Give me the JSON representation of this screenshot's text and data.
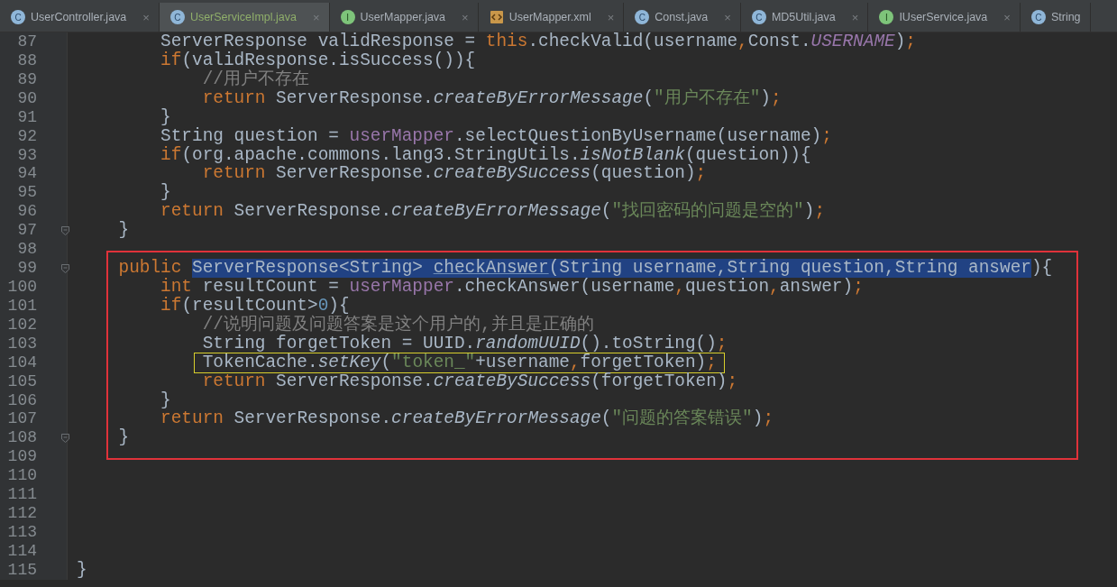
{
  "tabs": [
    {
      "label": "UserController.java",
      "kind": "class",
      "icon_letter": "C",
      "selected": false,
      "close": "×"
    },
    {
      "label": "UserServiceImpl.java",
      "kind": "class",
      "icon_letter": "C",
      "selected": true,
      "close": "×"
    },
    {
      "label": "UserMapper.java",
      "kind": "interface",
      "icon_letter": "I",
      "selected": false,
      "close": "×"
    },
    {
      "label": "UserMapper.xml",
      "kind": "xml",
      "selected": false,
      "close": "×"
    },
    {
      "label": "Const.java",
      "kind": "class",
      "icon_letter": "C",
      "selected": false,
      "close": "×"
    },
    {
      "label": "MD5Util.java",
      "kind": "class",
      "icon_letter": "C",
      "selected": false,
      "close": "×"
    },
    {
      "label": "IUserService.java",
      "kind": "interface",
      "icon_letter": "I",
      "selected": false,
      "close": "×"
    },
    {
      "label": "String",
      "kind": "class",
      "icon_letter": "C",
      "selected": false
    }
  ],
  "editor": {
    "sections": [
      {
        "boxed": false,
        "lines": [
          {
            "number": "87",
            "fold": false,
            "boxed": false,
            "tokens": [
              {
                "text": "        ServerResponse validResponse = ",
                "kind": "plain"
              },
              {
                "text": "this",
                "kind": "keyword"
              },
              {
                "text": ".checkValid(username",
                "kind": "plain"
              },
              {
                "text": ",",
                "kind": "keyword"
              },
              {
                "text": "Const.",
                "kind": "plain"
              },
              {
                "text": "USERNAME",
                "kind": "static-field"
              },
              {
                "text": ")",
                "kind": "plain"
              },
              {
                "text": ";",
                "kind": "keyword"
              }
            ]
          },
          {
            "number": "88",
            "fold": false,
            "boxed": false,
            "tokens": [
              {
                "text": "        if",
                "kind": "keyword"
              },
              {
                "text": "(validResponse.isSuccess()){",
                "kind": "plain"
              }
            ]
          },
          {
            "number": "89",
            "fold": false,
            "boxed": false,
            "tokens": [
              {
                "text": "            //用户不存在",
                "kind": "comment"
              }
            ]
          },
          {
            "number": "90",
            "fold": false,
            "boxed": false,
            "tokens": [
              {
                "text": "            return",
                "kind": "keyword"
              },
              {
                "text": " ServerResponse.",
                "kind": "plain"
              },
              {
                "text": "createByErrorMessage",
                "kind": "static"
              },
              {
                "text": "(",
                "kind": "plain"
              },
              {
                "text": "\"用户不存在\"",
                "kind": "string"
              },
              {
                "text": ")",
                "kind": "plain"
              },
              {
                "text": ";",
                "kind": "keyword"
              }
            ]
          },
          {
            "number": "91",
            "fold": false,
            "boxed": false,
            "tokens": [
              {
                "text": "        }",
                "kind": "plain"
              }
            ]
          },
          {
            "number": "92",
            "fold": false,
            "boxed": false,
            "tokens": [
              {
                "text": "        String question = ",
                "kind": "plain"
              },
              {
                "text": "userMapper",
                "kind": "field"
              },
              {
                "text": ".selectQuestionByUsername(username)",
                "kind": "plain"
              },
              {
                "text": ";",
                "kind": "keyword"
              }
            ]
          },
          {
            "number": "93",
            "fold": false,
            "boxed": false,
            "tokens": [
              {
                "text": "        if",
                "kind": "keyword"
              },
              {
                "text": "(org.apache.commons.lang3.StringUtils.",
                "kind": "plain"
              },
              {
                "text": "isNotBlank",
                "kind": "static"
              },
              {
                "text": "(question)){",
                "kind": "plain"
              }
            ]
          },
          {
            "number": "94",
            "fold": false,
            "boxed": false,
            "tokens": [
              {
                "text": "            return",
                "kind": "keyword"
              },
              {
                "text": " ServerResponse.",
                "kind": "plain"
              },
              {
                "text": "createBySuccess",
                "kind": "static"
              },
              {
                "text": "(question)",
                "kind": "plain"
              },
              {
                "text": ";",
                "kind": "keyword"
              }
            ]
          },
          {
            "number": "95",
            "fold": false,
            "boxed": false,
            "tokens": [
              {
                "text": "        }",
                "kind": "plain"
              }
            ]
          },
          {
            "number": "96",
            "fold": false,
            "boxed": false,
            "tokens": [
              {
                "text": "        return",
                "kind": "keyword"
              },
              {
                "text": " ServerResponse.",
                "kind": "plain"
              },
              {
                "text": "createByErrorMessage",
                "kind": "static"
              },
              {
                "text": "(",
                "kind": "plain"
              },
              {
                "text": "\"找回密码的问题是空的\"",
                "kind": "string"
              },
              {
                "text": ")",
                "kind": "plain"
              },
              {
                "text": ";",
                "kind": "keyword"
              }
            ]
          },
          {
            "number": "97",
            "fold": true,
            "boxed": false,
            "tokens": [
              {
                "text": "    }",
                "kind": "plain"
              }
            ]
          },
          {
            "number": "98",
            "fold": false
          }
        ]
      },
      {
        "boxed": true,
        "lines": [
          {
            "number": "99",
            "fold": true,
            "boxed": false,
            "tokens": [
              {
                "text": "    public ",
                "kind": "keyword",
                "selected": false
              },
              {
                "text": "ServerResponse<String> ",
                "kind": "plain",
                "selected": true
              },
              {
                "text": "checkAnswer",
                "kind": "declaration",
                "selected": true
              },
              {
                "text": "(String username,String question,String answer",
                "kind": "plain",
                "selected": true
              },
              {
                "text": "){",
                "kind": "plain",
                "selected": false
              }
            ]
          },
          {
            "number": "100",
            "fold": false,
            "boxed": false,
            "tokens": [
              {
                "text": "        int",
                "kind": "keyword"
              },
              {
                "text": " resultCount = ",
                "kind": "plain"
              },
              {
                "text": "userMapper",
                "kind": "field"
              },
              {
                "text": ".checkAnswer(username",
                "kind": "plain"
              },
              {
                "text": ",",
                "kind": "keyword"
              },
              {
                "text": "question",
                "kind": "plain"
              },
              {
                "text": ",",
                "kind": "keyword"
              },
              {
                "text": "answer)",
                "kind": "plain"
              },
              {
                "text": ";",
                "kind": "keyword"
              }
            ]
          },
          {
            "number": "101",
            "fold": false,
            "boxed": false,
            "tokens": [
              {
                "text": "        if",
                "kind": "keyword"
              },
              {
                "text": "(resultCount>",
                "kind": "plain"
              },
              {
                "text": "0",
                "kind": "number"
              },
              {
                "text": "){",
                "kind": "plain"
              }
            ]
          },
          {
            "number": "102",
            "fold": false,
            "boxed": false,
            "tokens": [
              {
                "text": "            //说明问题及问题答案是这个用户的,并且是正确的",
                "kind": "comment"
              }
            ]
          },
          {
            "number": "103",
            "fold": false,
            "boxed": false,
            "tokens": [
              {
                "text": "            String forgetToken = UUID.",
                "kind": "plain"
              },
              {
                "text": "randomUUID",
                "kind": "static"
              },
              {
                "text": "().toString()",
                "kind": "plain"
              },
              {
                "text": ";",
                "kind": "keyword"
              }
            ]
          },
          {
            "number": "104",
            "fold": false,
            "boxed": true,
            "tokens": [
              {
                "text": "            TokenCache.",
                "kind": "plain"
              },
              {
                "text": "setKey",
                "kind": "static"
              },
              {
                "text": "(",
                "kind": "plain"
              },
              {
                "text": "\"token_\"",
                "kind": "string"
              },
              {
                "text": "+username",
                "kind": "plain"
              },
              {
                "text": ",",
                "kind": "keyword"
              },
              {
                "text": "forgetToken)",
                "kind": "plain"
              },
              {
                "text": ";",
                "kind": "keyword"
              }
            ]
          },
          {
            "number": "105",
            "fold": false,
            "boxed": false,
            "tokens": [
              {
                "text": "            return",
                "kind": "keyword"
              },
              {
                "text": " ServerResponse.",
                "kind": "plain"
              },
              {
                "text": "createBySuccess",
                "kind": "static"
              },
              {
                "text": "(forgetToken)",
                "kind": "plain"
              },
              {
                "text": ";",
                "kind": "keyword"
              }
            ]
          },
          {
            "number": "106",
            "fold": false,
            "boxed": false,
            "tokens": [
              {
                "text": "        }",
                "kind": "plain"
              }
            ]
          },
          {
            "number": "107",
            "fold": false,
            "boxed": false,
            "tokens": [
              {
                "text": "        return",
                "kind": "keyword"
              },
              {
                "text": " ServerResponse.",
                "kind": "plain"
              },
              {
                "text": "createByErrorMessage",
                "kind": "static"
              },
              {
                "text": "(",
                "kind": "plain"
              },
              {
                "text": "\"问题的答案错误\"",
                "kind": "string"
              },
              {
                "text": ")",
                "kind": "plain"
              },
              {
                "text": ";",
                "kind": "keyword"
              }
            ]
          },
          {
            "number": "108",
            "fold": true,
            "boxed": false,
            "tokens": [
              {
                "text": "    }",
                "kind": "plain"
              }
            ]
          }
        ]
      },
      {
        "boxed": false,
        "lines": [
          {
            "number": "109",
            "fold": false
          },
          {
            "number": "110",
            "fold": false
          },
          {
            "number": "111",
            "fold": false
          },
          {
            "number": "112",
            "fold": false
          },
          {
            "number": "113",
            "fold": false
          },
          {
            "number": "114",
            "fold": false
          },
          {
            "number": "115",
            "fold": false,
            "boxed": false,
            "tokens": [
              {
                "text": "}",
                "kind": "plain"
              }
            ]
          }
        ]
      }
    ]
  }
}
